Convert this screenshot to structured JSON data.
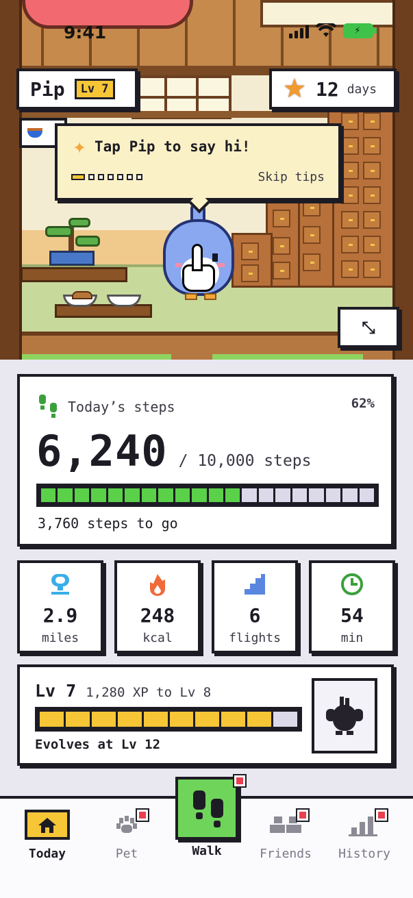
{
  "status_bar": {
    "time": "9:41"
  },
  "pet": {
    "name": "Pip",
    "level_badge": "Lv 7"
  },
  "streak": {
    "count": "12",
    "unit": "days"
  },
  "tip": {
    "message": "Tap Pip to say hi!",
    "skip_label": "Skip tips",
    "progress_step": 1,
    "progress_total": 7
  },
  "steps": {
    "title": "Today’s steps",
    "percent": "62%",
    "count": "6,240",
    "goal": "/ 10,000 steps",
    "remaining": "3,760 steps to go",
    "segments_total": 20,
    "segments_filled": 12,
    "color_filled": "#5bd14a",
    "color_empty": "#dcdaea"
  },
  "stats": [
    {
      "icon": "pin-icon",
      "value": "2.9",
      "label": "miles",
      "color": "#3aaee8"
    },
    {
      "icon": "flame-icon",
      "value": "248",
      "label": "kcal",
      "color": "#f06a3a"
    },
    {
      "icon": "stairs-icon",
      "value": "6",
      "label": "flights",
      "color": "#5a86e0"
    },
    {
      "icon": "clock-icon",
      "value": "54",
      "label": "min",
      "color": "#3aa03c"
    }
  ],
  "level": {
    "title": "Lv 7",
    "xp_text": "1,280 XP to Lv 8",
    "evolves_text": "Evolves at Lv 12",
    "segments_total": 10,
    "segments_filled": 9,
    "color_filled": "#f6c637",
    "color_empty": "#dcdaea"
  },
  "nav": {
    "today": "Today",
    "pet": "Pet",
    "walk": "Walk",
    "friends": "Friends",
    "history": "History"
  }
}
